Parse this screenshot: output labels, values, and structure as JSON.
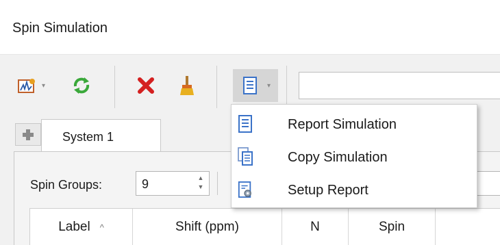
{
  "window": {
    "title": "Spin Simulation"
  },
  "toolbar": {
    "items": [
      {
        "icon": "spectrum-chart-add-icon",
        "has_dropdown": true
      },
      {
        "icon": "refresh-icon"
      },
      {
        "icon": "delete-x-icon"
      },
      {
        "icon": "clear-broom-icon"
      },
      {
        "icon": "report-icon",
        "has_dropdown": true,
        "active": true
      }
    ],
    "search": {
      "value": "",
      "placeholder": ""
    }
  },
  "tabs": {
    "add_icon": "plus-icon",
    "items": [
      {
        "label": "System 1",
        "active": true
      }
    ]
  },
  "spin_groups": {
    "label": "Spin Groups:",
    "value": "9"
  },
  "table": {
    "columns": [
      {
        "label": "Label",
        "sorted": "ascending"
      },
      {
        "label": "Shift (ppm)"
      },
      {
        "label": "N"
      },
      {
        "label": "Spin"
      },
      {
        "label": ""
      }
    ]
  },
  "report_menu": {
    "items": [
      {
        "label": "Report Simulation",
        "icon": "report-icon"
      },
      {
        "label": "Copy Simulation",
        "icon": "copy-report-icon"
      },
      {
        "label": "Setup Report",
        "icon": "setup-report-icon"
      }
    ]
  },
  "colors": {
    "delete": "#d42020",
    "refresh": "#3aa83a",
    "broom": "#e0a020",
    "accent": "#3a72c8"
  }
}
